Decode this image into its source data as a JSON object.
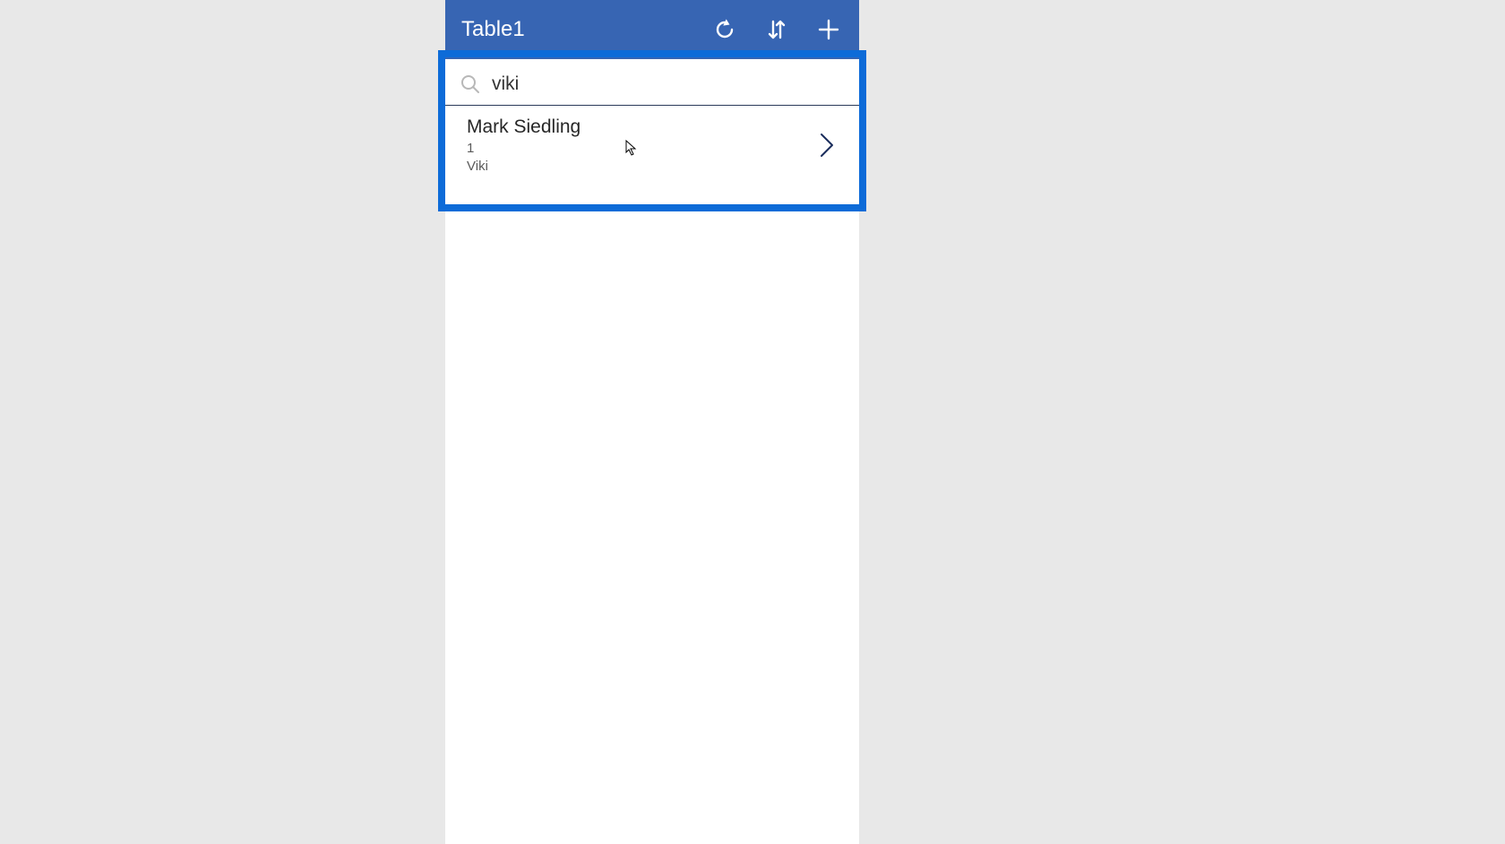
{
  "header": {
    "title": "Table1"
  },
  "search": {
    "value": "viki",
    "placeholder": ""
  },
  "results": [
    {
      "title": "Mark Siedling",
      "line2": "1",
      "line3": "Viki"
    }
  ],
  "colors": {
    "header_bg": "#3765b3",
    "highlight_border": "#0d6bd8",
    "chevron": "#1a2d5c"
  }
}
